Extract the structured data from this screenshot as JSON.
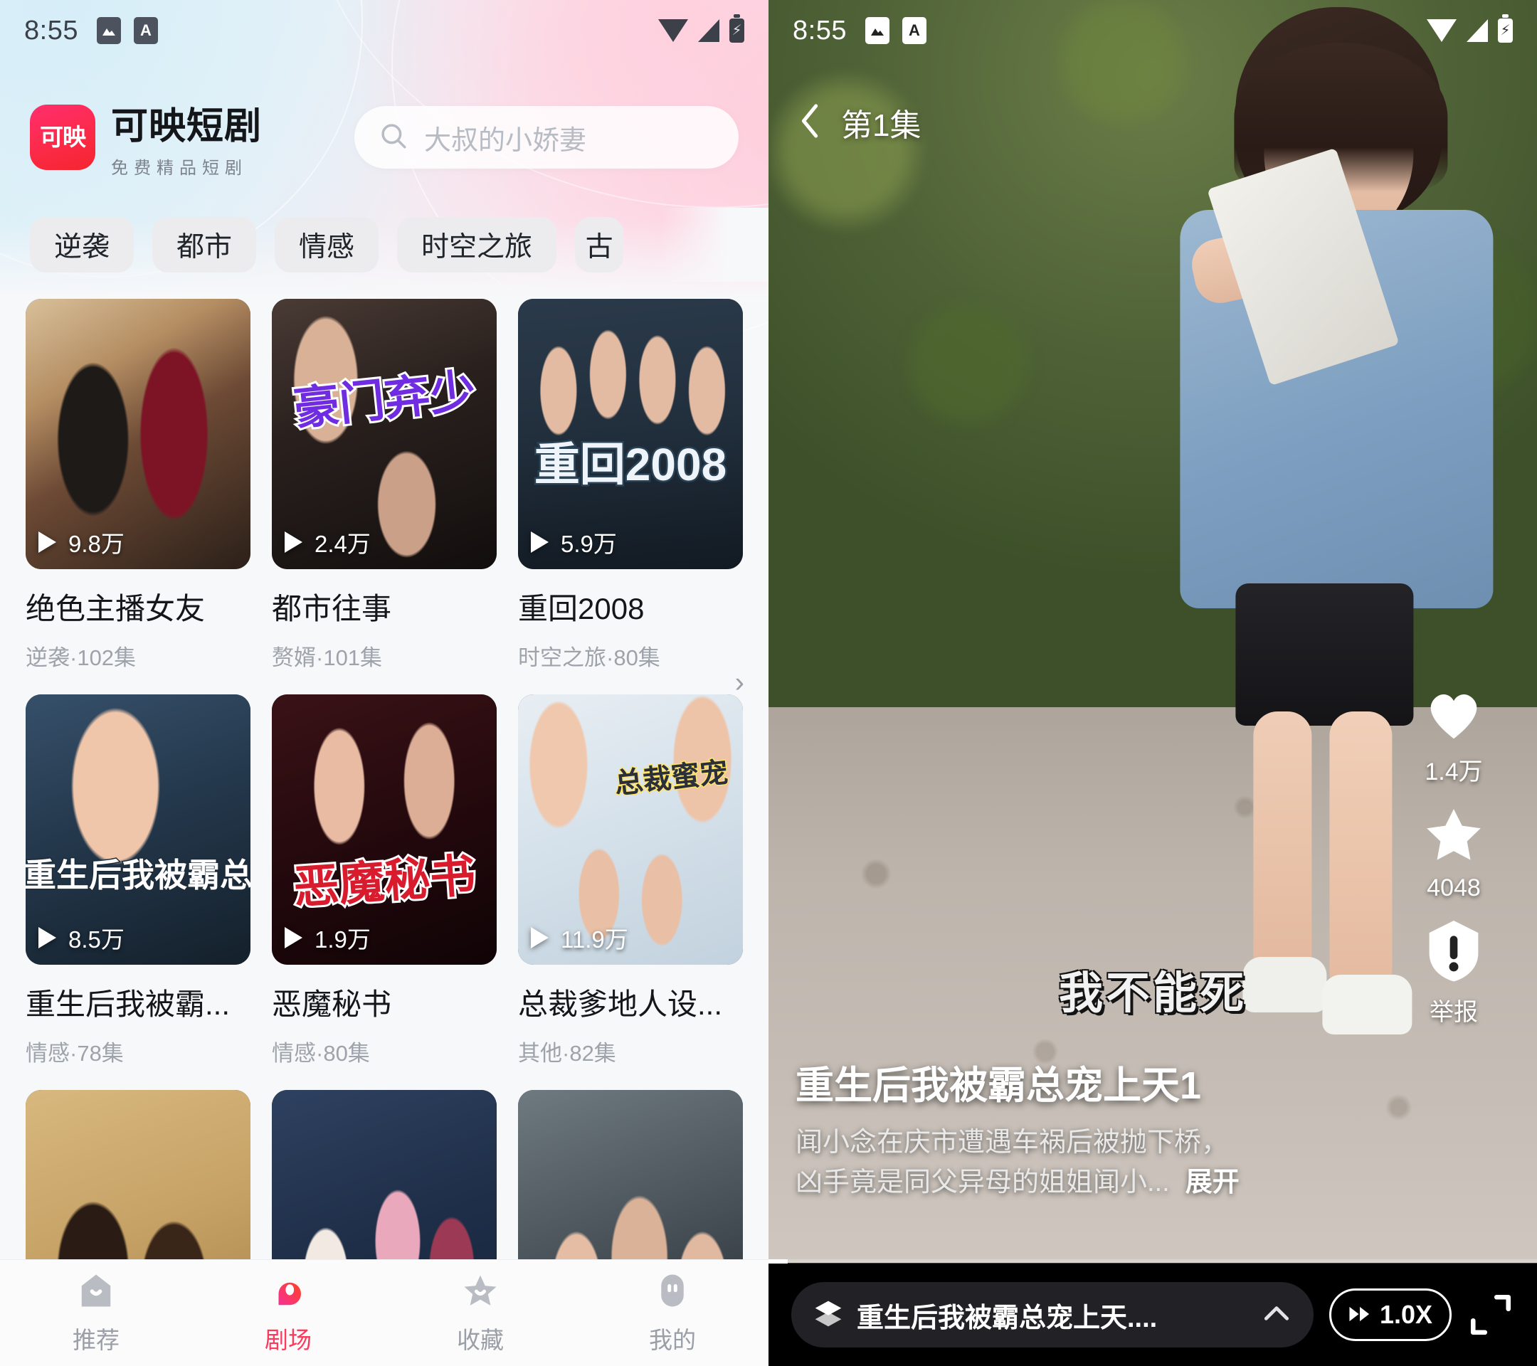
{
  "status_bar": {
    "time": "8:55",
    "icons": [
      "image-icon",
      "keyboard-a-icon"
    ],
    "right_icons": [
      "wifi-icon",
      "signal-icon",
      "battery-charging-icon"
    ]
  },
  "left_panel": {
    "brand": {
      "mark": "可映",
      "title": "可映短剧",
      "subtitle": "免费精品短剧",
      "accent": "#fb2a45"
    },
    "search": {
      "icon": "search-icon",
      "value": "大叔的小娇妻",
      "placeholder": "大叔的小娇妻"
    },
    "chips": [
      "逆袭",
      "都市",
      "情感",
      "时空之旅",
      "古"
    ],
    "chips_more_icon": "chevron-right-icon",
    "cards": [
      {
        "title": "绝色主播女友",
        "meta": "逆袭·102集",
        "plays": "9.8万",
        "overlay": ""
      },
      {
        "title": "都市往事",
        "meta": "赘婿·101集",
        "plays": "2.4万",
        "overlay": "豪门弃少"
      },
      {
        "title": "重回2008",
        "meta": "时空之旅·80集",
        "plays": "5.9万",
        "overlay": "重回2008"
      },
      {
        "title": "重生后我被霸...",
        "meta": "情感·78集",
        "plays": "8.5万",
        "overlay": "重生后我被霸总"
      },
      {
        "title": "恶魔秘书",
        "meta": "情感·80集",
        "plays": "1.9万",
        "overlay": "恶魔秘书"
      },
      {
        "title": "总裁爹地人设...",
        "meta": "其他·82集",
        "plays": "11.9万",
        "overlay": "总裁蜜宠"
      },
      {
        "title": "",
        "meta": "",
        "plays": "",
        "overlay": ""
      },
      {
        "title": "",
        "meta": "",
        "plays": "",
        "overlay": ""
      },
      {
        "title": "",
        "meta": "",
        "plays": "",
        "overlay": ""
      }
    ],
    "tabs": [
      {
        "label": "推荐",
        "icon": "home-icon",
        "active": false
      },
      {
        "label": "剧场",
        "icon": "theater-icon",
        "active": true
      },
      {
        "label": "收藏",
        "icon": "star-icon",
        "active": false
      },
      {
        "label": "我的",
        "icon": "profile-icon",
        "active": false
      }
    ],
    "active_accent": "#fb3b5c"
  },
  "right_panel": {
    "back_icon": "chevron-left-icon",
    "episode_label": "第1集",
    "actions": [
      {
        "icon": "heart-icon",
        "count": "1.4万"
      },
      {
        "icon": "star-icon",
        "count": "4048"
      },
      {
        "icon": "report-icon",
        "count": "举报"
      }
    ],
    "subtitle_overlay": "我不能死",
    "video_title": "重生后我被霸总宠上天1",
    "video_desc_line1": "闻小念在庆市遭遇车祸后被抛下桥，",
    "video_desc_line2": "凶手竟是同父异母的姐姐闻小...",
    "expand_label": "展开",
    "control_bar": {
      "list_icon": "episode-list-icon",
      "episode_title": "重生后我被霸总宠上天....",
      "chevron_up_icon": "chevron-up-icon",
      "speed_icon": "fast-forward-icon",
      "speed_label": "1.0X",
      "fullscreen_icon": "fullscreen-icon"
    }
  }
}
